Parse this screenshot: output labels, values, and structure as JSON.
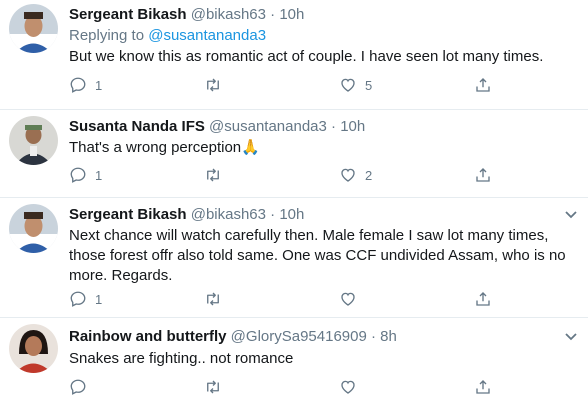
{
  "tweets": [
    {
      "name": "Sergeant Bikash",
      "handle": "@bikash63",
      "separator": "·",
      "time": "10h",
      "reply_prefix": "Replying to",
      "reply_mention": "@susantananda3",
      "text": "But we know this as romantic act of couple. I have seen lot many times.",
      "replies": "1",
      "retweets": "",
      "likes": "5"
    },
    {
      "name": "Susanta Nanda IFS",
      "handle": "@susantananda3",
      "separator": "·",
      "time": "10h",
      "text": "That's a wrong perception🙏",
      "replies": "1",
      "retweets": "",
      "likes": "2"
    },
    {
      "name": "Sergeant Bikash",
      "handle": "@bikash63",
      "separator": "·",
      "time": "10h",
      "text": "Next chance will watch carefully then. Male female I saw lot many times, those forest offr also told same. One was CCF  undivided Assam, who is no more. Regards.",
      "replies": "1",
      "retweets": "",
      "likes": ""
    },
    {
      "name": "Rainbow and butterfly",
      "handle": "@GlorySa95416909",
      "separator": "·",
      "time": "8h",
      "text": "Snakes are fighting.. not romance",
      "replies": "",
      "retweets": "",
      "likes": ""
    }
  ],
  "icons": {
    "reply": "reply-icon",
    "retweet": "retweet-icon",
    "like": "like-icon",
    "share": "share-icon",
    "more": "chevron-down-icon"
  },
  "colors": {
    "text": "#14171a",
    "muted": "#657786",
    "link": "#1b95e0",
    "divider": "#e6ecf0"
  }
}
